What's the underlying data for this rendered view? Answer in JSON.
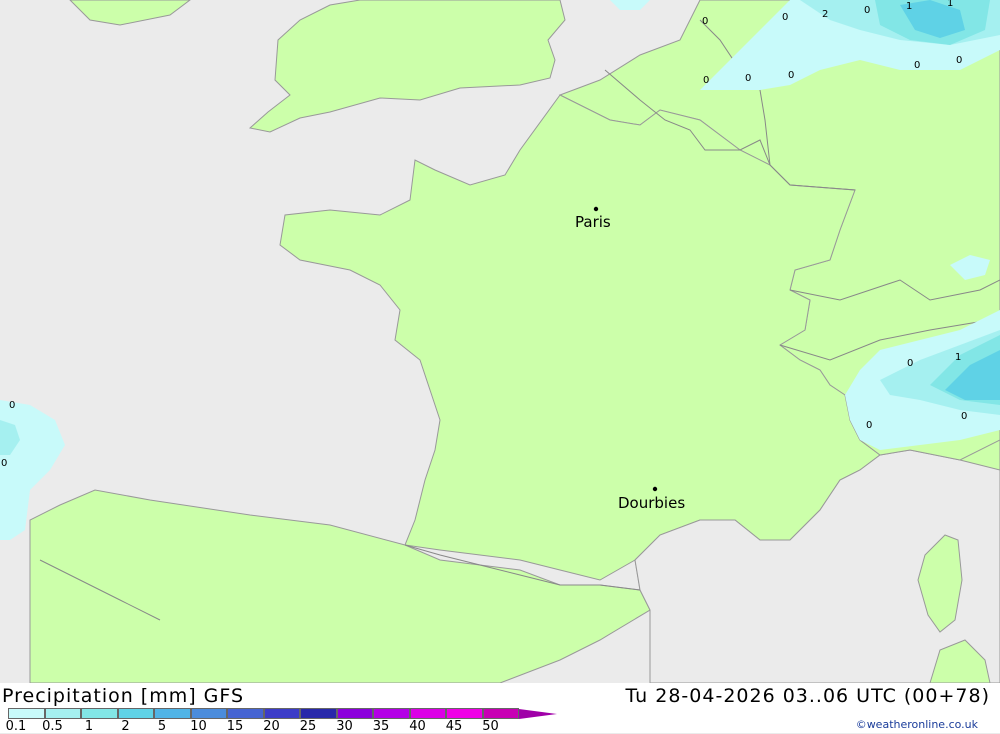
{
  "title": "Precipitation [mm] GFS",
  "datetime": "Tu 28-04-2026 03..06 UTC (00+78)",
  "credit": "©weatheronline.co.uk",
  "cities": [
    {
      "name": "Paris"
    },
    {
      "name": "Dourbies"
    }
  ],
  "precip_labels": [
    "0",
    "2",
    "0",
    "1",
    "1",
    "0",
    "0",
    "0",
    "0",
    "0",
    "0",
    "0",
    "1",
    "0",
    "0",
    "0",
    "0"
  ],
  "scale": {
    "ticks": [
      "0.1",
      "0.5",
      "1",
      "2",
      "5",
      "10",
      "15",
      "20",
      "25",
      "30",
      "35",
      "40",
      "45",
      "50"
    ],
    "colors": [
      "#c8fafa",
      "#a5f0f0",
      "#82e6e6",
      "#5fd2e6",
      "#50b4e6",
      "#4b8cdc",
      "#4664d2",
      "#3c3cc8",
      "#2828aa",
      "#8c00dc",
      "#b400e6",
      "#dc00e6",
      "#f000e6",
      "#c800b4"
    ]
  },
  "colors": {
    "land": "#ccff aa",
    "sea": "#ebebeb"
  }
}
